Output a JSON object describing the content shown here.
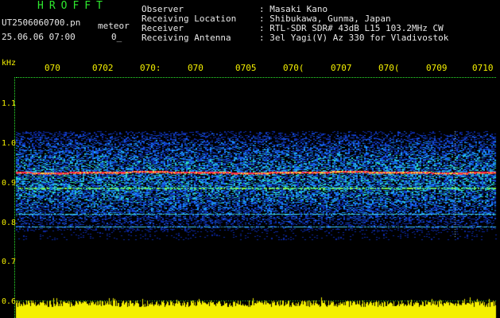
{
  "header": {
    "app_title": "HROFFT",
    "filename": "UT2506060700.pn",
    "mode": "meteor",
    "datetime": "25.06.06 07:00",
    "flag": "0_",
    "info": [
      {
        "label": "Observer",
        "value": ": Masaki Kano"
      },
      {
        "label": "Receiving Location",
        "value": ": Shibukawa, Gunma, Japan"
      },
      {
        "label": "Receiver",
        "value": ": RTL-SDR SDR# 43dB L15 103.2MHz CW"
      },
      {
        "label": "Receiving Antenna",
        "value": ": 3el Yagi(V) Az 330 for Vladivostok"
      }
    ]
  },
  "axes": {
    "unit": "kHz",
    "y_ticks": [
      "1.1",
      "1.0",
      "0.9",
      "0.8",
      "0.7",
      "0.6"
    ],
    "x_ticks": [
      "070",
      "0702",
      "070:",
      "070",
      "0705",
      "070(",
      "0707",
      "070(",
      "0709",
      "0710"
    ]
  },
  "colors": {
    "text_green": "#2ee82e",
    "text_yellow": "#f4f000",
    "background": "#000000",
    "signal_red": "#ff2b4a",
    "noise_blue": "#1a5cff"
  }
}
